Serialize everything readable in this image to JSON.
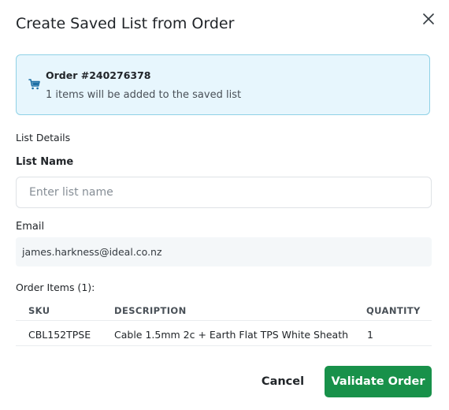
{
  "dialog": {
    "title": "Create Saved List from Order"
  },
  "order_info": {
    "order_number": "Order #240276378",
    "summary": "1 items will be added to the saved list"
  },
  "section_label": "List Details",
  "list_name": {
    "label": "List Name",
    "placeholder": "Enter list name",
    "value": ""
  },
  "email": {
    "label": "Email",
    "value": "james.harkness@ideal.co.nz"
  },
  "order_items": {
    "heading": "Order Items (1):",
    "columns": [
      "SKU",
      "DESCRIPTION",
      "QUANTITY"
    ],
    "rows": [
      {
        "sku": "CBL152TPSE",
        "description": "Cable 1.5mm 2c + Earth Flat TPS White Sheath",
        "quantity": "1"
      }
    ]
  },
  "actions": {
    "cancel": "Cancel",
    "validate": "Validate Order"
  },
  "colors": {
    "primary": "#18914a",
    "info_bg": "#e7f6fd",
    "info_border": "#8fd1e6",
    "icon_accent": "#1d6fa5"
  },
  "icons": {
    "close": "close-icon",
    "cart": "cart-icon"
  }
}
